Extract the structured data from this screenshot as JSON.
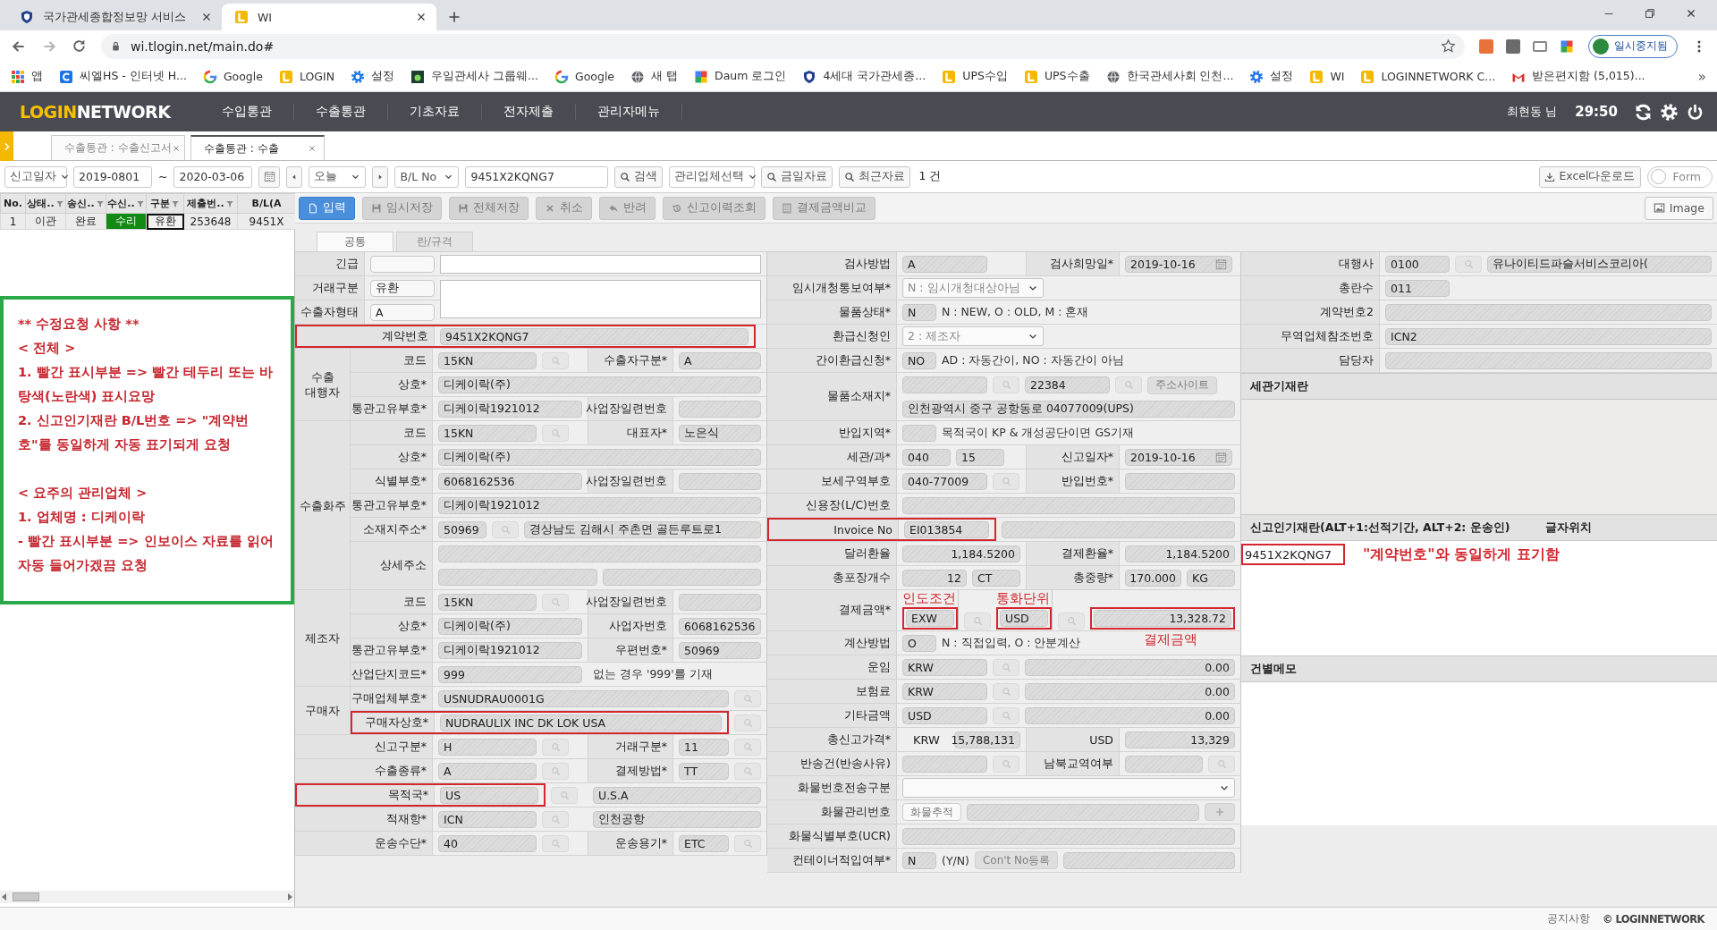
{
  "browser": {
    "tabs": [
      {
        "title": "국가관세종합정보망 서비스",
        "kind": "shield",
        "selected": false
      },
      {
        "title": "WI",
        "kind": "login",
        "selected": true
      }
    ],
    "url": "wi.tlogin.net/main.do#",
    "profile": "일시중지됨",
    "bookmarks": [
      {
        "label": "앱",
        "kind": "apps"
      },
      {
        "label": "씨엘HS - 인터넷 H...",
        "kind": "c"
      },
      {
        "label": "Google",
        "kind": "google"
      },
      {
        "label": "LOGIN",
        "kind": "login"
      },
      {
        "label": "설정",
        "kind": "gear"
      },
      {
        "label": "우일관세사 그룹웨...",
        "kind": "dh"
      },
      {
        "label": "Google",
        "kind": "google"
      },
      {
        "label": "새 탭",
        "kind": "globe"
      },
      {
        "label": "Daum 로그인",
        "kind": "daum"
      },
      {
        "label": "4세대 국가관세종...",
        "kind": "shield"
      },
      {
        "label": "UPS수입",
        "kind": "login"
      },
      {
        "label": "UPS수출",
        "kind": "login"
      },
      {
        "label": "한국관세사회 인천...",
        "kind": "globe"
      },
      {
        "label": "설정",
        "kind": "gear"
      },
      {
        "label": "WI",
        "kind": "login"
      },
      {
        "label": "LOGINNETWORK C...",
        "kind": "login"
      },
      {
        "label": "받은편지함 (5,015)...",
        "kind": "gmail"
      }
    ],
    "more": "»"
  },
  "app": {
    "logo": {
      "accent": "LOGIN",
      "rest": "NETWORK"
    },
    "menu": [
      "수입통관",
      "수출통관",
      "기초자료",
      "전자제출",
      "관리자메뉴"
    ],
    "user": "최현동 님",
    "timer": "29:50"
  },
  "doc_tabs": [
    {
      "title": "수출통관 : 수출신고서",
      "selected": false
    },
    {
      "title": "수출통관 : 수출",
      "selected": true
    }
  ],
  "toolbar": {
    "date_type": "신고일자",
    "date_from": "2019-0801",
    "range_sep": "~",
    "date_to": "2020-03-06",
    "period": "오늘",
    "key_type": "B/L No",
    "key_value": "9451X2KQNG7",
    "search": "검색",
    "company": "관리업체선택",
    "today": "금일자료",
    "recent": "최근자료",
    "count": "1 건",
    "excel": "Excel다운로드",
    "form_toggle": {
      "label": "Form",
      "on": false
    }
  },
  "list": {
    "columns": [
      {
        "label": "No.",
        "filter": false
      },
      {
        "label": "상태..",
        "filter": true
      },
      {
        "label": "송신..",
        "filter": true
      },
      {
        "label": "수신..",
        "filter": true
      },
      {
        "label": "구분",
        "filter": true
      },
      {
        "label": "제출번..",
        "filter": true
      },
      {
        "label": "B/L(A",
        "filter": false
      }
    ],
    "rows": [
      {
        "cells": [
          {
            "text": "1",
            "selected": false
          },
          {
            "text": "이관",
            "selected": false
          },
          {
            "text": "완료",
            "selected": false
          },
          {
            "text": "수리",
            "selected": false,
            "color": "#138a13"
          },
          {
            "text": "유환",
            "selected": true
          },
          {
            "text": "253648",
            "selected": false
          },
          {
            "text": "9451X",
            "selected": false
          }
        ]
      }
    ]
  },
  "note": [
    {
      "lines": [
        "** 수정요청 사항 **",
        "< 전체 >",
        "1. 빨간 표시부분 => 빨간 테두리 또는 바탕색(노란색) 표시요망",
        "2. 신고인기재란 B/L번호 => \"계약번호\"를 동일하게 자동 표기되게 요청"
      ]
    },
    {
      "lines": [
        "< 요주의 관리업체 >",
        "1. 업체명 : 디케이락",
        "- 빨간 표시부분 => 인보이스 자료를 읽어 자동 들어가겠끔 요청"
      ]
    }
  ],
  "actions": [
    {
      "label": "입력",
      "kind": "file",
      "disabled": false
    },
    {
      "label": "임시저장",
      "kind": "save",
      "disabled": true
    },
    {
      "label": "전체저장",
      "kind": "save",
      "disabled": true
    },
    {
      "label": "취소",
      "kind": "x",
      "disabled": true
    },
    {
      "label": "반려",
      "kind": "reply",
      "disabled": true
    },
    {
      "label": "신고이력조회",
      "kind": "history",
      "disabled": true
    },
    {
      "label": "결제금액비교",
      "kind": "calc",
      "disabled": true
    }
  ],
  "image_button": "Image",
  "form": {
    "tabs": [
      {
        "label": "공통",
        "selected": true
      },
      {
        "label": "란/규격",
        "selected": false
      }
    ],
    "left": {
      "sections": [
        {
          "kind": "compact",
          "rows": [
            {
              "label": "긴급",
              "cells": [
                {
                  "kind": "input"
                },
                {
                  "kind": "textbox"
                }
              ]
            }
          ]
        },
        {
          "kind": "memo",
          "rows": [
            {
              "label": "거래구분",
              "cells": [
                {
                  "kind": "input",
                  "value": "유환"
                }
              ]
            },
            {
              "label": "수출자형태",
              "cells": [
                {
                  "kind": "input",
                  "value": "A"
                }
              ]
            }
          ]
        },
        {
          "kind": "plain",
          "rows": [
            {
              "label": "계약번호",
              "marked": true,
              "cells": [
                {
                  "kind": "field",
                  "value": "9451X2KQNG7"
                }
              ]
            }
          ]
        },
        {
          "kind": "group",
          "title": "수출 대행자",
          "rows": [
            {
              "label": "코드",
              "cells": [
                {
                  "kind": "code",
                  "value": "15KN"
                },
                {
                  "kind": "lookup"
                }
              ],
              "label2": "수출자구분*",
              "cells2": [
                {
                  "kind": "field",
                  "value": "A"
                }
              ]
            },
            {
              "label": "상호*",
              "cells": [
                {
                  "kind": "field",
                  "value": "디케이락(주)"
                }
              ]
            },
            {
              "label": "통관고유부호*",
              "cells": [
                {
                  "kind": "field",
                  "value": "디케이락1921012"
                }
              ],
              "label2": "사업장일련번호",
              "cells2": [
                {
                  "kind": "field"
                }
              ]
            }
          ]
        },
        {
          "kind": "group",
          "title": "수출화주",
          "rows": [
            {
              "label": "코드",
              "cells": [
                {
                  "kind": "code",
                  "value": "15KN"
                },
                {
                  "kind": "lookup"
                }
              ],
              "label2": "대표자*",
              "cells2": [
                {
                  "kind": "field",
                  "value": "노은식"
                }
              ]
            },
            {
              "label": "상호*",
              "cells": [
                {
                  "kind": "field",
                  "value": "디케이락(주)"
                }
              ]
            },
            {
              "label": "식별부호*",
              "cells": [
                {
                  "kind": "field",
                  "value": "6068162536"
                }
              ],
              "label2": "사업장일련번호",
              "cells2": [
                {
                  "kind": "field"
                }
              ]
            },
            {
              "label": "통관고유부호*",
              "cells": [
                {
                  "kind": "field",
                  "value": "디케이락1921012"
                }
              ]
            },
            {
              "label": "소재지주소*",
              "cells": [
                {
                  "kind": "short",
                  "value": "50969"
                },
                {
                  "kind": "lookup"
                },
                {
                  "kind": "field",
                  "value": "경상남도 김해시 주촌면 골든루트로1"
                }
              ]
            },
            {
              "label": "상세주소",
              "lines": [
                [
                  {
                    "kind": "field"
                  }
                ],
                [
                  {
                    "kind": "field"
                  },
                  {
                    "kind": "field"
                  }
                ]
              ]
            }
          ]
        },
        {
          "kind": "group",
          "title": "제조자",
          "rows": [
            {
              "label": "코드",
              "cells": [
                {
                  "kind": "code",
                  "value": "15KN"
                },
                {
                  "kind": "lookup"
                }
              ],
              "label2": "사업장일련번호",
              "cells2": [
                {
                  "kind": "field"
                }
              ]
            },
            {
              "label": "상호*",
              "cells": [
                {
                  "kind": "field",
                  "value": "디케이락(주)"
                }
              ],
              "label2": "사업자번호",
              "cells2": [
                {
                  "kind": "field",
                  "value": "6068162536"
                }
              ]
            },
            {
              "label": "통관고유부호*",
              "cells": [
                {
                  "kind": "field",
                  "value": "디케이락1921012"
                }
              ],
              "label2": "우편번호*",
              "cells2": [
                {
                  "kind": "field",
                  "value": "50969"
                }
              ]
            },
            {
              "label": "산업단지코드*",
              "cells": [
                {
                  "kind": "field",
                  "value": "999"
                }
              ],
              "cells2": [
                {
                  "kind": "note",
                  "text": "없는 경우 '999'를 기재"
                }
              ]
            }
          ]
        },
        {
          "kind": "group",
          "title": "구매자",
          "rows": [
            {
              "label": "구매업체부호*",
              "cells": [
                {
                  "kind": "field",
                  "value": "USNUDRAU0001G"
                },
                {
                  "kind": "lookup"
                }
              ]
            },
            {
              "label": "구매자상호*",
              "marked": true,
              "cells": [
                {
                  "kind": "field",
                  "value": "NUDRAULIX INC DK LOK USA"
                },
                {
                  "kind": "lookup"
                }
              ]
            }
          ]
        },
        {
          "kind": "plain",
          "rows": [
            {
              "label": "신고구분*",
              "cells": [
                {
                  "kind": "code",
                  "value": "H"
                },
                {
                  "kind": "lookup"
                }
              ],
              "label2": "거래구분*",
              "cells2": [
                {
                  "kind": "code",
                  "value": "11"
                },
                {
                  "kind": "lookup"
                }
              ]
            },
            {
              "label": "수출종류*",
              "cells": [
                {
                  "kind": "code",
                  "value": "A"
                },
                {
                  "kind": "lookup"
                }
              ],
              "label2": "결제방법*",
              "cells2": [
                {
                  "kind": "code",
                  "value": "TT"
                },
                {
                  "kind": "lookup"
                }
              ]
            },
            {
              "label": "목적국*",
              "marked": true,
              "cells": [
                {
                  "kind": "code",
                  "value": "US"
                },
                {
                  "kind": "lookup"
                }
              ],
              "cells2": [
                {
                  "kind": "field",
                  "value": "U.S.A"
                }
              ]
            },
            {
              "label": "적재항*",
              "cells": [
                {
                  "kind": "code",
                  "value": "ICN"
                },
                {
                  "kind": "lookup"
                }
              ],
              "cells2": [
                {
                  "kind": "field",
                  "value": "인천공항"
                }
              ]
            },
            {
              "label": "운송수단*",
              "cells": [
                {
                  "kind": "code",
                  "value": "40"
                },
                {
                  "kind": "lookup"
                }
              ],
              "label2": "운송용기*",
              "cells2": [
                {
                  "kind": "code",
                  "value": "ETC"
                },
                {
                  "kind": "lookup"
                }
              ]
            }
          ]
        }
      ]
    },
    "middle": {
      "rows": [
        {
          "label": "검사방법",
          "cells": [
            {
              "kind": "code",
              "value": "A"
            }
          ],
          "label2": "검사희망일*",
          "cells2": [
            {
              "kind": "date",
              "value": "2019-10-16"
            }
          ]
        },
        {
          "label": "임시개청통보여부*",
          "cells": [
            {
              "kind": "select",
              "value": "N : 임시개청대상아님"
            }
          ]
        },
        {
          "label": "물품상태*",
          "cells": [
            {
              "kind": "flag",
              "value": "N"
            },
            {
              "kind": "note",
              "text": "N : NEW, O : OLD, M : 혼재"
            }
          ]
        },
        {
          "label": "환급신청인",
          "cells": [
            {
              "kind": "select",
              "value": "2 : 제조자"
            }
          ]
        },
        {
          "label": "간이환급신청*",
          "cells": [
            {
              "kind": "flag",
              "value": "NO"
            },
            {
              "kind": "note",
              "text": "AD : 자동간이, NO : 자동간이 아님"
            }
          ]
        },
        {
          "label": "물품소재지*",
          "lines": [
            [
              {
                "kind": "code"
              },
              {
                "kind": "lookup"
              },
              {
                "kind": "code",
                "value": "22384"
              },
              {
                "kind": "lookup"
              },
              {
                "kind": "button",
                "label": "주소사이트",
                "disabled": true
              }
            ],
            [
              {
                "kind": "field",
                "value": "인천광역시 중구 공항동로 04077009(UPS)"
              }
            ]
          ]
        },
        {
          "label": "반입지역*",
          "cells": [
            {
              "kind": "flag"
            },
            {
              "kind": "note",
              "text": "목적국이 KP & 개성공단이면 GS기재"
            }
          ]
        },
        {
          "label": "세관/과*",
          "cells": [
            {
              "kind": "short",
              "value": "040"
            },
            {
              "kind": "short",
              "value": "15"
            }
          ],
          "label2": "신고일자*",
          "cells2": [
            {
              "kind": "date",
              "value": "2019-10-16"
            }
          ]
        },
        {
          "label": "보세구역부호",
          "cells": [
            {
              "kind": "code",
              "value": "040-77009"
            },
            {
              "kind": "lookup"
            }
          ],
          "label2": "반입번호*",
          "cells2": [
            {
              "kind": "field"
            }
          ]
        },
        {
          "label": "신용장(L/C)번호",
          "cells": [
            {
              "kind": "field"
            }
          ]
        },
        {
          "label": "Invoice No",
          "marked": true,
          "cells": [
            {
              "kind": "code",
              "value": "EI013854"
            },
            {
              "kind": "field"
            }
          ]
        },
        {
          "label": "달러환율",
          "cells": [
            {
              "kind": "amount",
              "value": "1,184.5200"
            }
          ],
          "label2": "결제환율*",
          "cells2": [
            {
              "kind": "amount",
              "value": "1,184.5200"
            }
          ]
        },
        {
          "label": "총포장개수",
          "cells": [
            {
              "kind": "amount",
              "value": "12"
            },
            {
              "kind": "short",
              "value": "CT"
            }
          ],
          "label2": "총중량*",
          "cells2": [
            {
              "kind": "amount",
              "value": "170.000"
            },
            {
              "kind": "short",
              "value": "KG"
            }
          ]
        },
        {
          "label": "결제금액*",
          "cells": [
            {
              "kind": "short",
              "value": "EXW",
              "marked": true,
              "callout": "인도조건"
            },
            {
              "kind": "lookup"
            },
            {
              "kind": "short",
              "value": "USD",
              "marked": true,
              "callout": "통화단위"
            },
            {
              "kind": "lookup"
            },
            {
              "kind": "amount",
              "value": "13,328.72",
              "marked": true,
              "callout": "결제금액"
            }
          ]
        },
        {
          "label": "계산방법",
          "cells": [
            {
              "kind": "flag",
              "value": "O"
            },
            {
              "kind": "note",
              "text": "N : 직접입력, O : 안분계산"
            }
          ]
        },
        {
          "label": "운임",
          "cells": [
            {
              "kind": "code",
              "value": "KRW"
            },
            {
              "kind": "lookup"
            },
            {
              "kind": "amount",
              "value": "0.00"
            }
          ]
        },
        {
          "label": "보험료",
          "cells": [
            {
              "kind": "code",
              "value": "KRW"
            },
            {
              "kind": "lookup"
            },
            {
              "kind": "amount",
              "value": "0.00"
            }
          ]
        },
        {
          "label": "기타금액",
          "cells": [
            {
              "kind": "code",
              "value": "USD"
            },
            {
              "kind": "lookup"
            },
            {
              "kind": "amount",
              "value": "0.00"
            }
          ]
        },
        {
          "label": "총신고가격*",
          "cells": [
            {
              "kind": "unit",
              "text": "KRW"
            },
            {
              "kind": "amount",
              "value": "15,788,131"
            }
          ],
          "label2": "USD",
          "cells2": [
            {
              "kind": "amount",
              "value": "13,329"
            }
          ]
        },
        {
          "label": "반송건(반송사유)",
          "cells": [
            {
              "kind": "code"
            },
            {
              "kind": "lookup"
            }
          ],
          "label2": "남북교역여부",
          "cells2": [
            {
              "kind": "code"
            },
            {
              "kind": "lookup"
            }
          ]
        },
        {
          "label": "화물번호전송구분",
          "cells": [
            {
              "kind": "dropdown"
            }
          ]
        },
        {
          "label": "화물관리번호",
          "cells": [
            {
              "kind": "button",
              "label": "화물추적",
              "disabled": false
            },
            {
              "kind": "field"
            },
            {
              "kind": "plus",
              "disabled": true
            }
          ]
        },
        {
          "label": "화물식별부호(UCR)",
          "cells": [
            {
              "kind": "field"
            }
          ]
        },
        {
          "label": "컨테이너적입여부*",
          "cells": [
            {
              "kind": "flag",
              "value": "N"
            },
            {
              "kind": "note",
              "text": "(Y/N)"
            },
            {
              "kind": "button",
              "label": "Con't No등록",
              "disabled": true
            },
            {
              "kind": "field"
            }
          ]
        }
      ]
    },
    "right": {
      "rows": [
        {
          "label": "대행사",
          "cells": [
            {
              "kind": "code",
              "value": "0100"
            },
            {
              "kind": "lookup"
            },
            {
              "kind": "field",
              "value": "유나이티드파슬서비스코리아("
            }
          ]
        },
        {
          "label": "총란수",
          "cells": [
            {
              "kind": "code",
              "value": "011"
            }
          ]
        },
        {
          "label": "계약번호2",
          "cells": [
            {
              "kind": "field"
            }
          ]
        },
        {
          "label": "무역업체참조번호",
          "cells": [
            {
              "kind": "field",
              "value": "ICN2"
            }
          ]
        },
        {
          "label": "담당자",
          "cells": [
            {
              "kind": "field"
            }
          ]
        }
      ],
      "panels": [
        {
          "title": "세관기재란",
          "kind": "readonly"
        },
        {
          "title": "신고인기재란(ALT+1:선적기간, ALT+2: 운송인)",
          "extra": "글자위치",
          "kind": "entry",
          "value": "9451X2KQNG7",
          "marked": true,
          "callout": "\"계약번호\"와 동일하게 표기함"
        },
        {
          "title": "건별메모",
          "kind": "entry"
        }
      ]
    }
  },
  "footer": {
    "notice": "공지사항",
    "copyright": "© LOGINNETWORK"
  }
}
